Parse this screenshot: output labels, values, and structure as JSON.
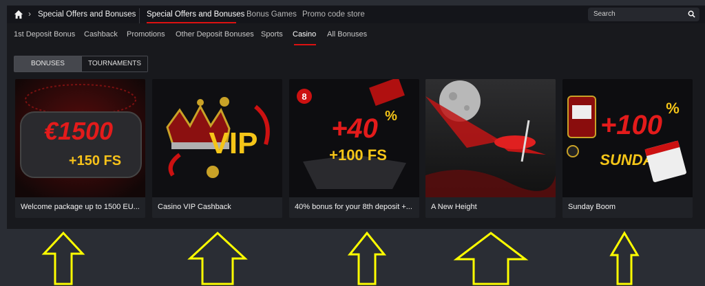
{
  "topbar": {
    "breadcrumb": "Special Offers and Bonuses",
    "tabs": [
      {
        "label": "Special Offers and Bonuses"
      },
      {
        "label": "Bonus Games"
      },
      {
        "label": "Promo code store"
      }
    ],
    "search_placeholder": "Search"
  },
  "subnav": [
    {
      "label": "1st Deposit Bonus"
    },
    {
      "label": "Cashback"
    },
    {
      "label": "Promotions"
    },
    {
      "label": "Other Deposit Bonuses"
    },
    {
      "label": "Sports"
    },
    {
      "label": "Casino"
    },
    {
      "label": "All Bonuses"
    }
  ],
  "toggle": {
    "bonuses": "BONUSES",
    "tournaments": "TOURNAMENTS"
  },
  "cards": [
    {
      "caption": "Welcome package up to 1500 EU...",
      "art_main": "€1500",
      "art_sub": "+150 FS"
    },
    {
      "caption": "Casino VIP Cashback",
      "art_main": "VIP"
    },
    {
      "caption": "40% bonus for your 8th deposit +...",
      "art_main": "+40",
      "art_pct": "%",
      "art_sub": "+100 FS",
      "art_badge": "8"
    },
    {
      "caption": "A New Height"
    },
    {
      "caption": "Sunday Boom",
      "art_main": "+100",
      "art_pct": "%",
      "art_sub": "SUNDAY"
    }
  ],
  "colors": {
    "accent": "#dd1111",
    "gold": "#f5c518",
    "arrow": "#ffff00"
  }
}
